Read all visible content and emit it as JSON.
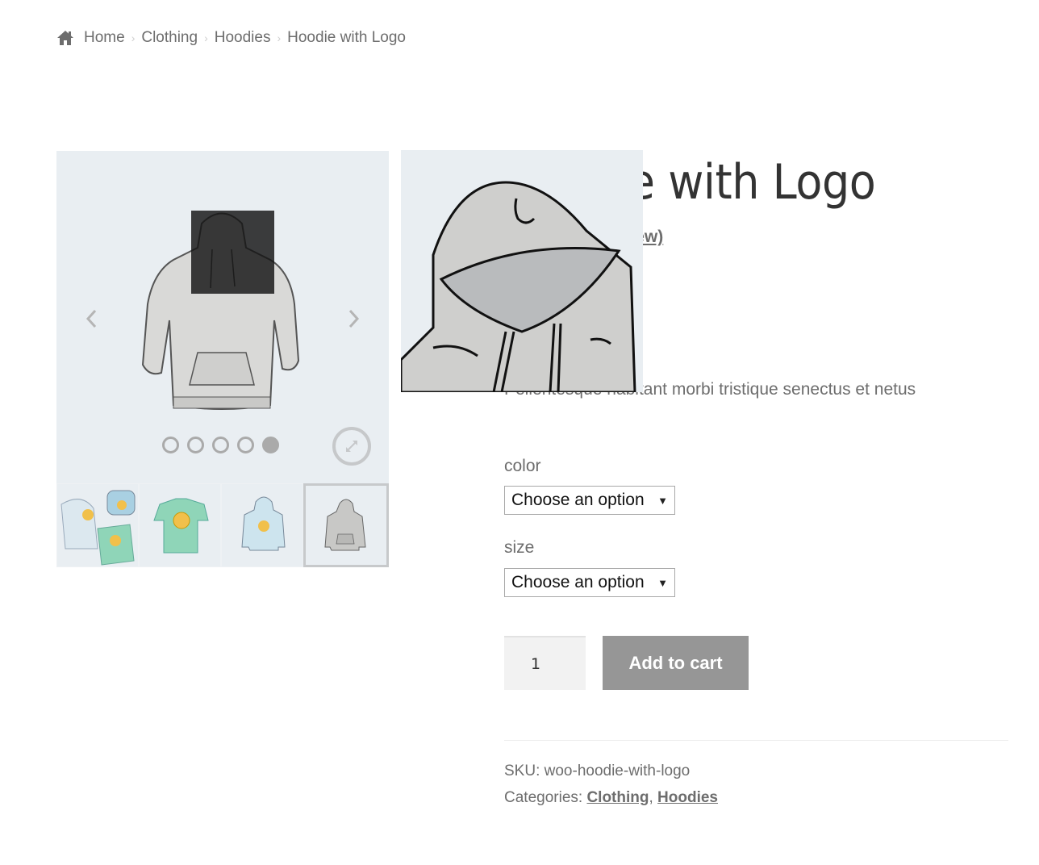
{
  "breadcrumb": {
    "icon": "home-icon",
    "items": [
      "Home",
      "Clothing",
      "Hoodies",
      "Hoodie with Logo"
    ],
    "separator": "›"
  },
  "gallery": {
    "main_image_alt": "Gray hoodie",
    "dots_count": 5,
    "active_dot": 5,
    "thumbnails": [
      {
        "alt": "Hoodies, beanie and shirt set",
        "active": false
      },
      {
        "alt": "Green V-neck t-shirt with logo",
        "active": false
      },
      {
        "alt": "Light blue hoodie with logo",
        "active": false
      },
      {
        "alt": "Gray hoodie",
        "active": true
      }
    ],
    "prev_icon": "chevron-left-icon",
    "next_icon": "chevron-right-icon",
    "zoom_icon": "expand-icon"
  },
  "product": {
    "title": "Hoodie with Logo",
    "title_visible": "e with Logo",
    "review_link": "(1 customer review)",
    "review_link_visible": "customer review)",
    "short_description": "Pellentesque habitant morbi tristique senectus et netus",
    "attributes": [
      {
        "label": "color",
        "selected": "Choose an option"
      },
      {
        "label": "size",
        "selected": "Choose an option"
      }
    ],
    "quantity": "1",
    "add_to_cart_label": "Add to cart",
    "sku_label": "SKU:",
    "sku": "woo-hoodie-with-logo",
    "categories_label": "Categories:",
    "categories": [
      "Clothing",
      "Hoodies"
    ]
  },
  "colors": {
    "button_bg": "#969696",
    "text": "#6d6d6d",
    "title": "#333333",
    "image_bg": "#e9eef2"
  }
}
